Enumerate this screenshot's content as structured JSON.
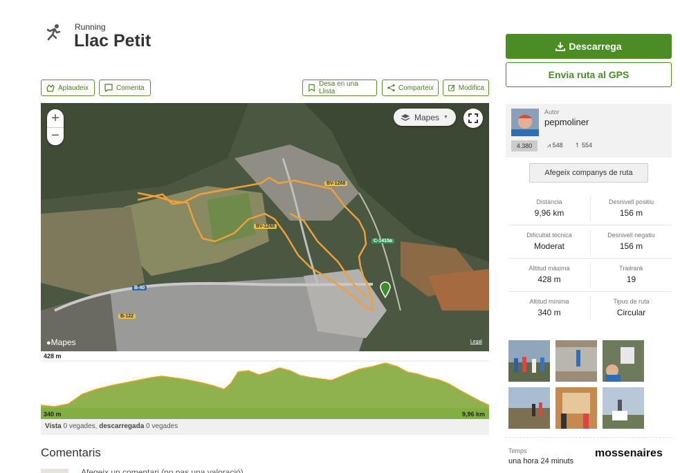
{
  "header": {
    "activity": "Running",
    "title": "Llac Petit",
    "icon": "running-icon"
  },
  "actions": {
    "applaud": "Aplaudeix",
    "comment": "Comenta",
    "save_list": "Desa en una Llista",
    "share": "Comparteix",
    "edit": "Modifica"
  },
  "map": {
    "layers_label": "Mapes",
    "zoom_in": "+",
    "zoom_out": "−",
    "provider": "Mapes",
    "legal": "Legal",
    "roads": [
      "BV-1268",
      "BV-1268",
      "C-1415a",
      "B-40",
      "B-122"
    ]
  },
  "elevation": {
    "max": "428 m",
    "min": "340 m",
    "distance": "9,96 km",
    "fill_color": "#7fae44",
    "line_color": "#e7a32c"
  },
  "views": {
    "vista_label": "Vista",
    "vista_text": " 0 vegades, ",
    "downloaded_label": "descarregada",
    "downloaded_text": " 0 vegades"
  },
  "comments": {
    "title": "Comentaris",
    "preview": "Afegeix un comentari (no pas una valoració)"
  },
  "sidebar": {
    "download": "Descarrega",
    "send_gps": "Envia ruta al GPS",
    "author_label": "Autor",
    "author_name": "pepmoliner",
    "score": "4.380",
    "stat_routes": "548",
    "stat_followers": "554",
    "add_companions": "Afegeix companys de ruta",
    "accent": "#4b8c24"
  },
  "stats": [
    {
      "label": "Distància",
      "value": "9,96 km"
    },
    {
      "label": "Desnivell positiu",
      "value": "156 m"
    },
    {
      "label": "Dificultat tècnica",
      "value": "Moderat"
    },
    {
      "label": "Desnivell negatiu",
      "value": "156 m"
    },
    {
      "label": "Altitud màxima",
      "value": "428 m"
    },
    {
      "label": "Trailrank",
      "value": "19"
    },
    {
      "label": "Altitud mínima",
      "value": "340 m"
    },
    {
      "label": "Tipus de ruta",
      "value": "Circular"
    }
  ],
  "time": {
    "label": "Temps",
    "value": "una hora 24 minuts"
  },
  "watermark": "mossenaires"
}
